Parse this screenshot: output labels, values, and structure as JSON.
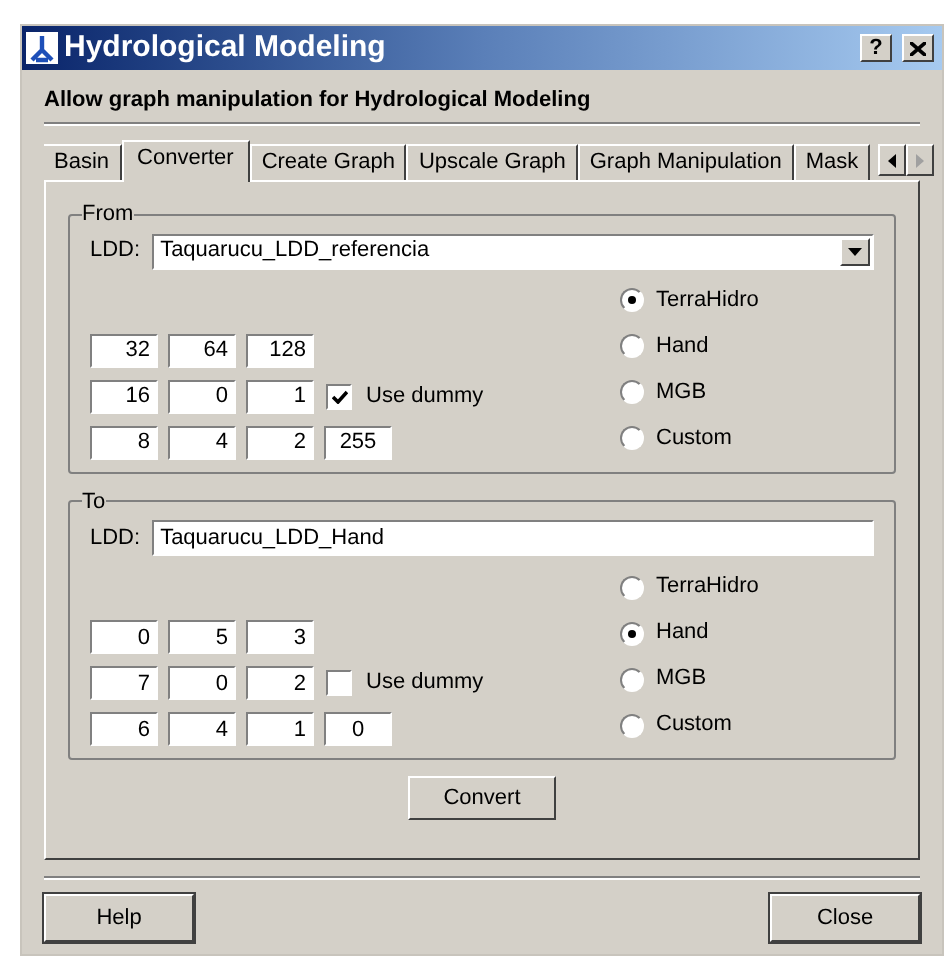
{
  "window": {
    "title": "Hydrological Modeling",
    "help_glyph": "?"
  },
  "subtitle": "Allow graph manipulation for Hydrological Modeling",
  "tabs": [
    {
      "label": "Basin",
      "selected": false
    },
    {
      "label": "Converter",
      "selected": true
    },
    {
      "label": "Create Graph",
      "selected": false
    },
    {
      "label": "Upscale Graph",
      "selected": false
    },
    {
      "label": "Graph Manipulation",
      "selected": false
    },
    {
      "label": "Mask",
      "selected": false
    }
  ],
  "groups": [
    {
      "legend": "From",
      "ldd_label": "LDD:",
      "ldd": {
        "kind": "dropdown",
        "value": "Taquarucu_LDD_referencia"
      },
      "grid": [
        [
          "32",
          "64",
          "128"
        ],
        [
          "16",
          "0",
          "1"
        ],
        [
          "8",
          "4",
          "2",
          "255"
        ]
      ],
      "use_dummy": {
        "label": "Use dummy",
        "checked": true
      },
      "formats": [
        {
          "label": "TerraHidro",
          "selected": true
        },
        {
          "label": "Hand",
          "selected": false
        },
        {
          "label": "MGB",
          "selected": false
        },
        {
          "label": "Custom",
          "selected": false
        }
      ]
    },
    {
      "legend": "To",
      "ldd_label": "LDD:",
      "ldd": {
        "kind": "text",
        "value": "Taquarucu_LDD_Hand"
      },
      "grid": [
        [
          "0",
          "5",
          "3"
        ],
        [
          "7",
          "0",
          "2"
        ],
        [
          "6",
          "4",
          "1",
          "0"
        ]
      ],
      "use_dummy": {
        "label": "Use dummy",
        "checked": false
      },
      "formats": [
        {
          "label": "TerraHidro",
          "selected": false
        },
        {
          "label": "Hand",
          "selected": true
        },
        {
          "label": "MGB",
          "selected": false
        },
        {
          "label": "Custom",
          "selected": false
        }
      ]
    }
  ],
  "convert_button": "Convert",
  "footer_buttons": [
    "Help",
    "Close"
  ]
}
